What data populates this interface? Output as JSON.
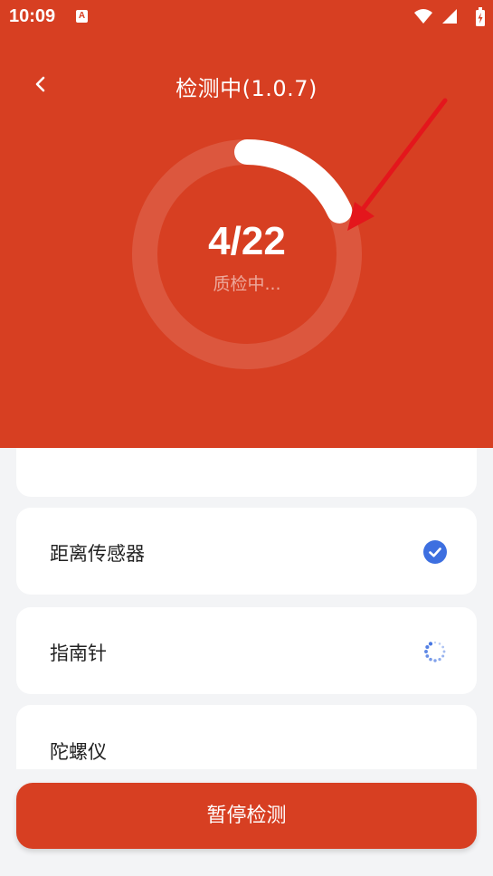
{
  "colors": {
    "primary": "#d73f22",
    "check": "#3d6fe0",
    "background": "#f3f4f6"
  },
  "status_bar": {
    "time": "10:09",
    "notification_badge": "A"
  },
  "header": {
    "title": "检测中(1.0.7)",
    "back_icon": "chevron-left-icon"
  },
  "progress": {
    "count": "4/22",
    "status": "质检中...",
    "current": 4,
    "total": 22,
    "fraction": 0.18
  },
  "items": [
    {
      "label": "",
      "state": "done"
    },
    {
      "label": "距离传感器",
      "state": "done"
    },
    {
      "label": "指南针",
      "state": "loading"
    },
    {
      "label": "陀螺仪",
      "state": "pending"
    }
  ],
  "footer": {
    "pause_label": "暂停检测"
  }
}
